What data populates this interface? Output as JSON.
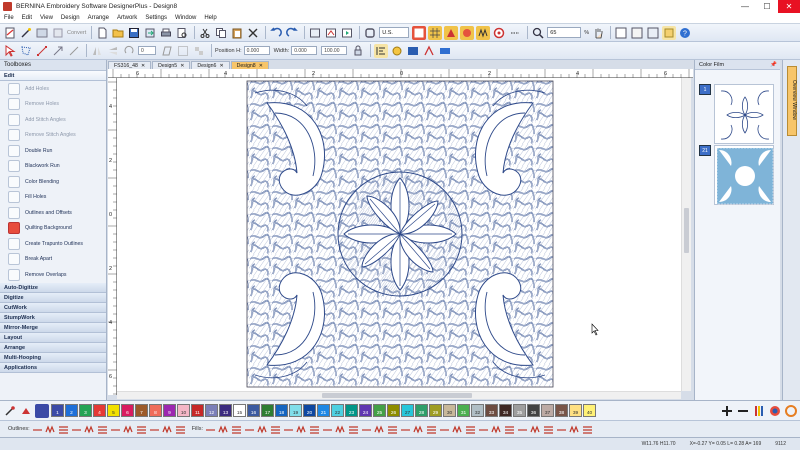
{
  "window": {
    "title": "BERNINA Embroidery Software DesignerPlus - Design8",
    "minimize": "—",
    "maximize": "☐",
    "close": "✕"
  },
  "menu": [
    "File",
    "Edit",
    "View",
    "Design",
    "Arrange",
    "Artwork",
    "Settings",
    "Window",
    "Help"
  ],
  "toolbar": {
    "convert_label": "Convert",
    "hoop_value": "U.S.",
    "zoom_value": "65",
    "zoom_unit": "%",
    "position_h_label": "Position H:",
    "position_h_value": "0.000",
    "position_v_label": "Position V:",
    "position_v_value": "0.000",
    "width_label": "Width:",
    "width_value": "0.000",
    "height_label": "Height:",
    "height_value": "0.000",
    "scale_w_value": "100.00",
    "scale_h_value": "100.00",
    "rotate_value": "0"
  },
  "toolboxes": {
    "title": "Toolboxes",
    "sections_top": [
      "Edit"
    ],
    "tools": [
      {
        "label": "Add Holes",
        "state": "dim"
      },
      {
        "label": "Remove Holes",
        "state": "dim"
      },
      {
        "label": "Add Stitch Angles",
        "state": "dim"
      },
      {
        "label": "Remove Stitch Angles",
        "state": "dim"
      },
      {
        "label": "Double Run",
        "state": "normal"
      },
      {
        "label": "Blackwork Run",
        "state": "normal"
      },
      {
        "label": "Color Blending",
        "state": "normal"
      },
      {
        "label": "Fill Holes",
        "state": "normal"
      },
      {
        "label": "Outlines and Offsets",
        "state": "normal"
      },
      {
        "label": "Quilting Background",
        "state": "sel"
      },
      {
        "label": "Create Trapunto Outlines",
        "state": "normal"
      },
      {
        "label": "Break Apart",
        "state": "normal"
      },
      {
        "label": "Remove Overlaps",
        "state": "normal"
      }
    ],
    "sections_bottom": [
      "Auto-Digitize",
      "Digitize",
      "CutWork",
      "StumpWork",
      "Mirror-Merge",
      "Layout",
      "Arrange",
      "Multi-Hooping",
      "Applications"
    ]
  },
  "doc_tabs": [
    {
      "label": "FS316_48",
      "active": false
    },
    {
      "label": "Design5",
      "active": false
    },
    {
      "label": "Design6",
      "active": false
    },
    {
      "label": "Design8",
      "active": true
    }
  ],
  "ruler": {
    "top_ticks": [
      "6",
      "4",
      "2",
      "0",
      "2",
      "4",
      "6"
    ],
    "left_ticks": [
      "4",
      "2",
      "0",
      "2",
      "4",
      "6"
    ]
  },
  "color_film": {
    "title": "Color Film",
    "items": [
      {
        "num": "1"
      },
      {
        "num": "21"
      }
    ]
  },
  "overview_tab": "Overview Window",
  "palette": {
    "swatches": [
      {
        "n": "1",
        "c": "#3b4aa6"
      },
      {
        "n": "2",
        "c": "#1e6fd8"
      },
      {
        "n": "3",
        "c": "#23a455"
      },
      {
        "n": "4",
        "c": "#e53935"
      },
      {
        "n": "5",
        "c": "#f1e000"
      },
      {
        "n": "6",
        "c": "#d81b60"
      },
      {
        "n": "7",
        "c": "#9c5a2a"
      },
      {
        "n": "8",
        "c": "#ef6c5a"
      },
      {
        "n": "9",
        "c": "#9c27b0"
      },
      {
        "n": "10",
        "c": "#f4b6c6"
      },
      {
        "n": "11",
        "c": "#c62828"
      },
      {
        "n": "12",
        "c": "#7b7fb8"
      },
      {
        "n": "13",
        "c": "#3a2a80"
      },
      {
        "n": "15",
        "c": "#ffffff"
      },
      {
        "n": "16",
        "c": "#3b5aa0"
      },
      {
        "n": "17",
        "c": "#2e7d32"
      },
      {
        "n": "18",
        "c": "#1565c0"
      },
      {
        "n": "19",
        "c": "#80deea"
      },
      {
        "n": "20",
        "c": "#0d47a1"
      },
      {
        "n": "21",
        "c": "#1e88e5"
      },
      {
        "n": "22",
        "c": "#4dd0e1"
      },
      {
        "n": "23",
        "c": "#009688"
      },
      {
        "n": "24",
        "c": "#5e35b1"
      },
      {
        "n": "25",
        "c": "#43a047"
      },
      {
        "n": "26",
        "c": "#8d8d00"
      },
      {
        "n": "27",
        "c": "#26c6da"
      },
      {
        "n": "28",
        "c": "#2e9e6a"
      },
      {
        "n": "29",
        "c": "#9e9d24"
      },
      {
        "n": "30",
        "c": "#c8b89a"
      },
      {
        "n": "31",
        "c": "#4caf50"
      },
      {
        "n": "32",
        "c": "#b0bec5"
      },
      {
        "n": "33",
        "c": "#6d4c41"
      },
      {
        "n": "34",
        "c": "#3e2723"
      },
      {
        "n": "35",
        "c": "#9e9e9e"
      },
      {
        "n": "36",
        "c": "#424242"
      },
      {
        "n": "37",
        "c": "#bcaaa4"
      },
      {
        "n": "38",
        "c": "#795548"
      },
      {
        "n": "39",
        "c": "#ffe082"
      },
      {
        "n": "40",
        "c": "#fff176"
      }
    ]
  },
  "outline_bar": {
    "outlines_label": "Outlines:",
    "fills_label": "Fills:"
  },
  "status": {
    "size": "W11.76 H11.70",
    "coords": "X=-0.27 Y= 0.05 L= 0.28 A= 169",
    "stitches": "9112"
  },
  "colors": {
    "stitch": "#2f4a8a",
    "accent_tab": "#f7c56a"
  }
}
